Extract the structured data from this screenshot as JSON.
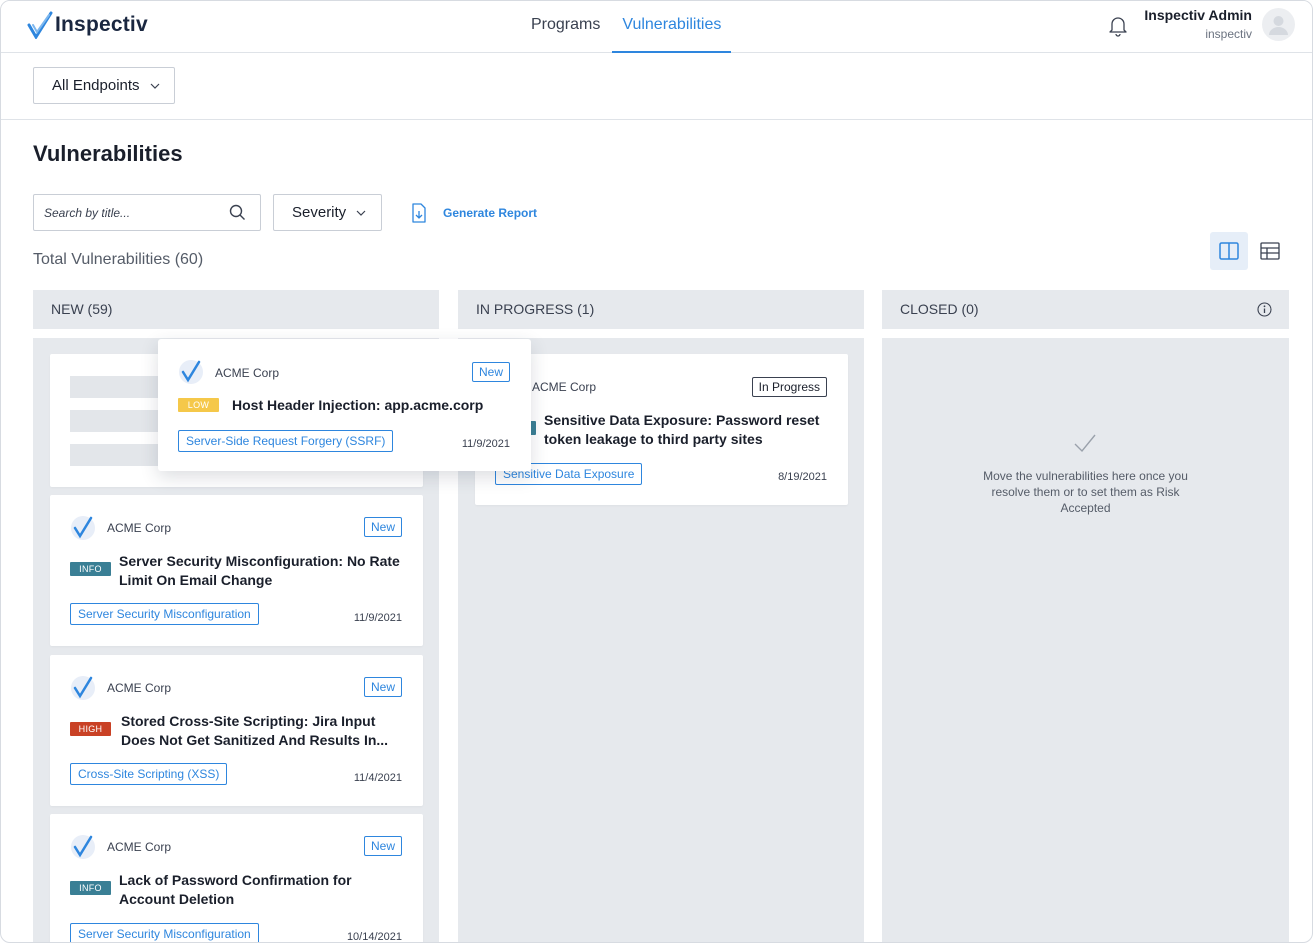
{
  "app": {
    "brand": "Inspectiv",
    "nav": [
      "Programs",
      "Vulnerabilities"
    ],
    "active_nav": "Vulnerabilities",
    "user": {
      "name": "Inspectiv Admin",
      "org": "inspectiv"
    }
  },
  "filters": {
    "endpoint": "All Endpoints",
    "search_placeholder": "Search by title...",
    "severity": "Severity",
    "generate_report": "Generate Report"
  },
  "page": {
    "title": "Vulnerabilities",
    "total": "Total Vulnerabilities (60)"
  },
  "columns": {
    "new": "NEW (59)",
    "in_progress": "IN PROGRESS (1)",
    "closed": "CLOSED (0)",
    "closed_empty": "Move the vulnerabilities here once you resolve them or to set them as Risk Accepted"
  },
  "dragging_card": {
    "org": "ACME Corp",
    "status": "New",
    "severity": "LOW",
    "title": "Host Header Injection: app.acme.corp",
    "category": "Server-Side Request Forgery (SSRF)",
    "date": "11/9/2021"
  },
  "new_cards": [
    {
      "org": "ACME Corp",
      "status": "New",
      "severity": "INFO",
      "title_line1": "Server Security Misconfiguration: No Rate",
      "title_line2": "Limit On Email Change",
      "category": "Server Security Misconfiguration",
      "date": "11/9/2021"
    },
    {
      "org": "ACME Corp",
      "status": "New",
      "severity": "HIGH",
      "title_line1": "Stored Cross-Site Scripting: Jira Input",
      "title_line2": "Does Not Get Sanitized And Results In...",
      "category": "Cross-Site Scripting (XSS)",
      "date": "11/4/2021"
    },
    {
      "org": "ACME Corp",
      "status": "New",
      "severity": "INFO",
      "title_line1": "Lack of Password Confirmation for",
      "title_line2": "Account Deletion",
      "category": "Server Security Misconfiguration",
      "date": "10/14/2021"
    }
  ],
  "progress_cards": [
    {
      "org": "ACME Corp",
      "status": "In Progress",
      "title_line1": "Sensitive Data Exposure: Password reset",
      "title_line2": "token leakage to third party sites",
      "category": "Sensitive Data Exposure",
      "date": "8/19/2021"
    }
  ],
  "colors": {
    "accent": "#2e86de",
    "info": "#3a7f95",
    "high": "#c94125",
    "low": "#f5c84a",
    "column_bg": "#e6e9ed"
  }
}
